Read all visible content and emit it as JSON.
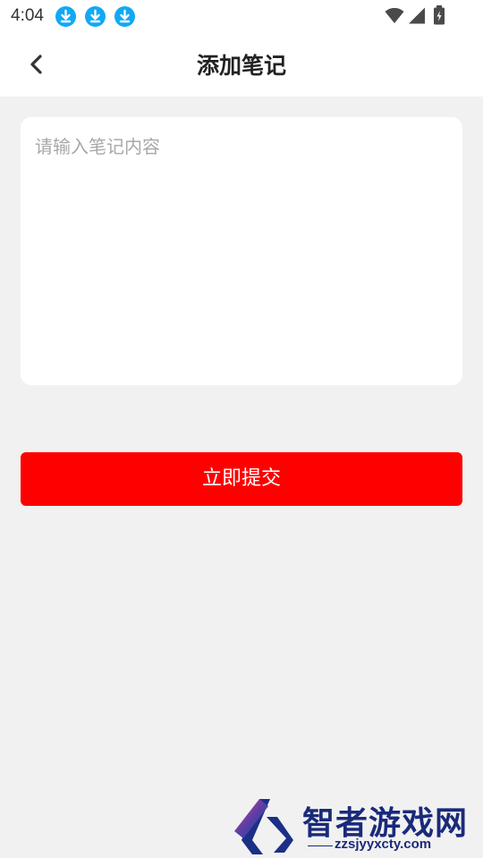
{
  "status_bar": {
    "time": "4:04",
    "icons": [
      "download-icon",
      "download-icon",
      "download-icon",
      "wifi-icon",
      "signal-icon",
      "battery-charging-icon"
    ]
  },
  "header": {
    "title": "添加笔记",
    "back_icon": "chevron-left-icon"
  },
  "note": {
    "placeholder": "请输入笔记内容",
    "value": ""
  },
  "submit": {
    "label": "立即提交"
  },
  "watermark": {
    "brand": "智者游戏网",
    "url": "zzsjyyxcty.com"
  },
  "colors": {
    "accent": "#ff0000",
    "background": "#f1f1f1",
    "download_badge": "#11a9f5"
  }
}
